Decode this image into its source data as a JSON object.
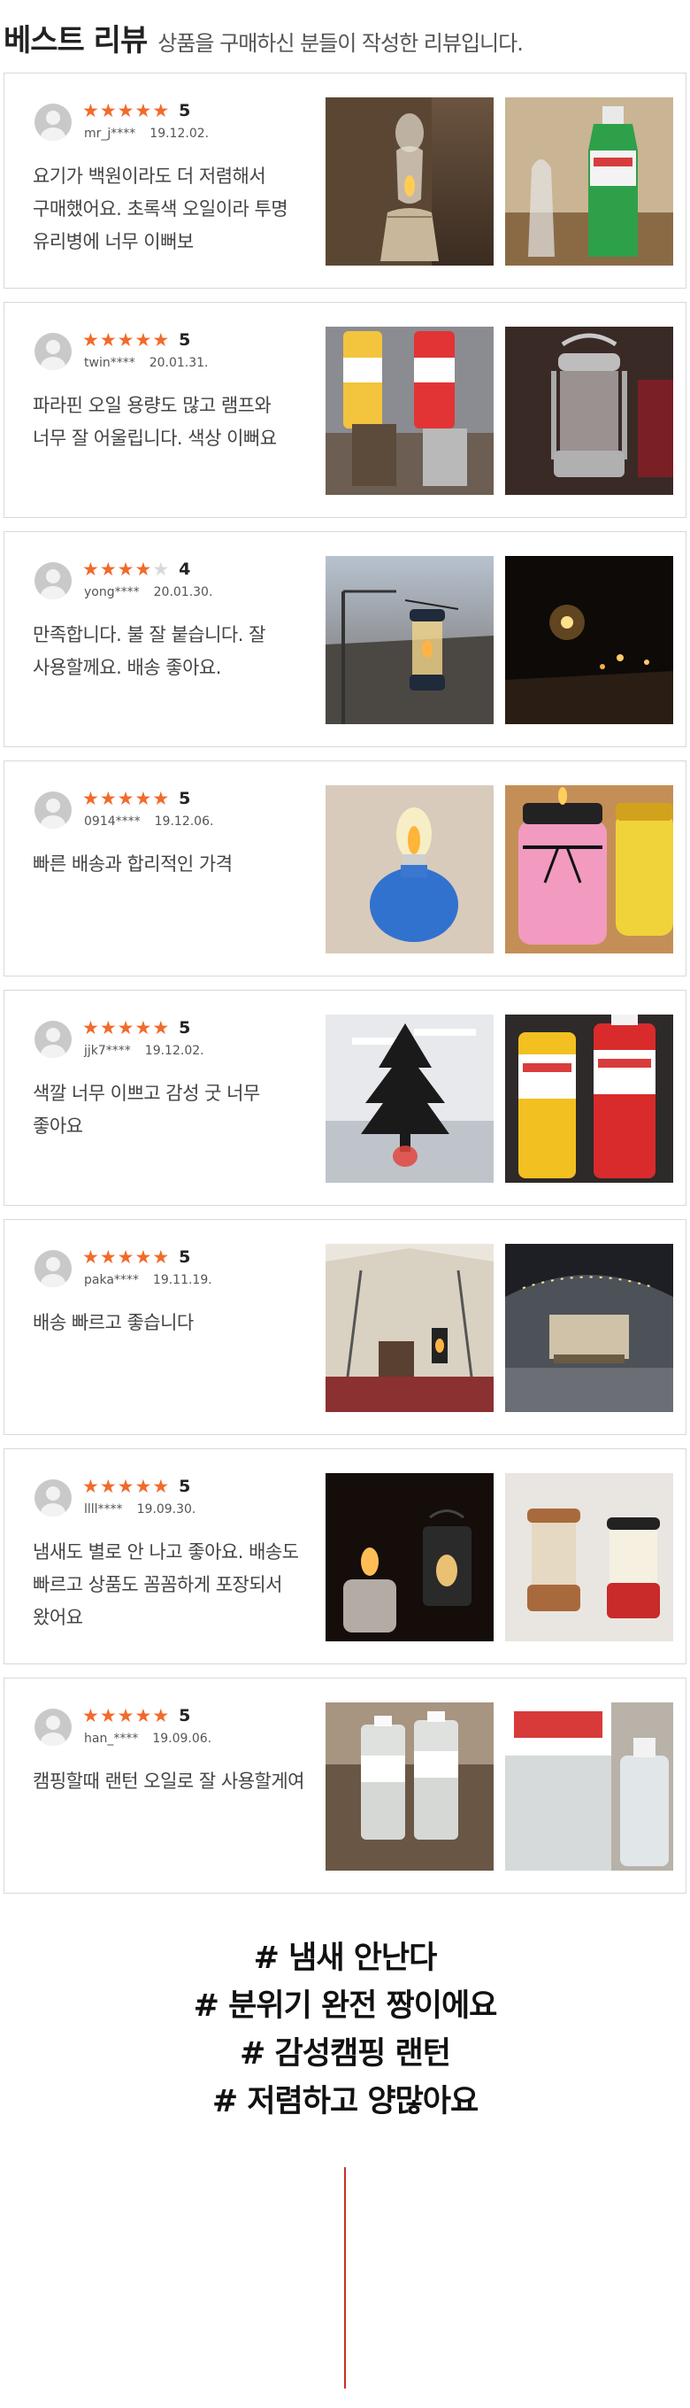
{
  "header": {
    "title": "베스트 리뷰",
    "subtitle": "상품을 구매하신 분들이 작성한 리뷰입니다."
  },
  "reviews": [
    {
      "rating": 5,
      "rating_label": "5",
      "user": "mr_j****",
      "date": "19.12.02.",
      "text": "요기가 백원이라도 더 저렴해서 구매했어요. 초록색 오일이라 투명 유리병에 너무 이뻐보",
      "photos": [
        "oil-lamp-photo",
        "green-oil-bottle-photo"
      ]
    },
    {
      "rating": 5,
      "rating_label": "5",
      "user": "twin****",
      "date": "20.01.31.",
      "text": "파라핀 오일 용량도 많고 램프와 너무 잘 어울립니다. 색상 이뻐요",
      "photos": [
        "paraffin-bottles-photo",
        "silver-lantern-photo"
      ]
    },
    {
      "rating": 4,
      "rating_label": "4",
      "user": "yong****",
      "date": "20.01.30.",
      "text": "만족합니다. 불 잘 붙습니다. 잘 사용할께요. 배송 좋아요.",
      "photos": [
        "hanging-lantern-photo",
        "night-campsite-photo"
      ]
    },
    {
      "rating": 5,
      "rating_label": "5",
      "user": "0914****",
      "date": "19.12.06.",
      "text": "빠른 배송과 합리적인 가격",
      "photos": [
        "blue-oil-lamp-photo",
        "pink-jar-lamp-photo"
      ]
    },
    {
      "rating": 5,
      "rating_label": "5",
      "user": "jjk7****",
      "date": "19.12.02.",
      "text": "색깔 너무 이쁘고 감성 굿 너무 좋아요",
      "photos": [
        "tree-lamp-photo",
        "red-yellow-oil-bottles-photo"
      ]
    },
    {
      "rating": 5,
      "rating_label": "5",
      "user": "paka****",
      "date": "19.11.19.",
      "text": "배송 빠르고 좋습니다",
      "photos": [
        "tent-interior-photo",
        "car-camping-photo"
      ]
    },
    {
      "rating": 5,
      "rating_label": "5",
      "user": "llll****",
      "date": "19.09.30.",
      "text": "냄새도 별로 안 나고 좋아요. 배송도 빠르고 상품도 꼼꼼하게 포장되서 왔어요",
      "photos": [
        "lit-lanterns-photo",
        "copper-lanterns-photo"
      ]
    },
    {
      "rating": 5,
      "rating_label": "5",
      "user": "han_****",
      "date": "19.09.06.",
      "text": "캠핑할때 랜턴 오일로 잘 사용할게여",
      "photos": [
        "clear-oil-bottles-photo",
        "paraffin-label-bottle-photo"
      ]
    }
  ],
  "hashtags": [
    "# 냄새 안난다",
    "# 분위기 완전 짱이에요",
    "# 감성캠핑 랜턴",
    "# 저렴하고 양많아요"
  ],
  "colors": {
    "star_active": "#f26a2a",
    "star_inactive": "#d9d9d9",
    "divider": "#c9302c",
    "card_border": "#d8d8d8"
  },
  "icons": {
    "star": "★",
    "avatar": "avatar-icon"
  }
}
